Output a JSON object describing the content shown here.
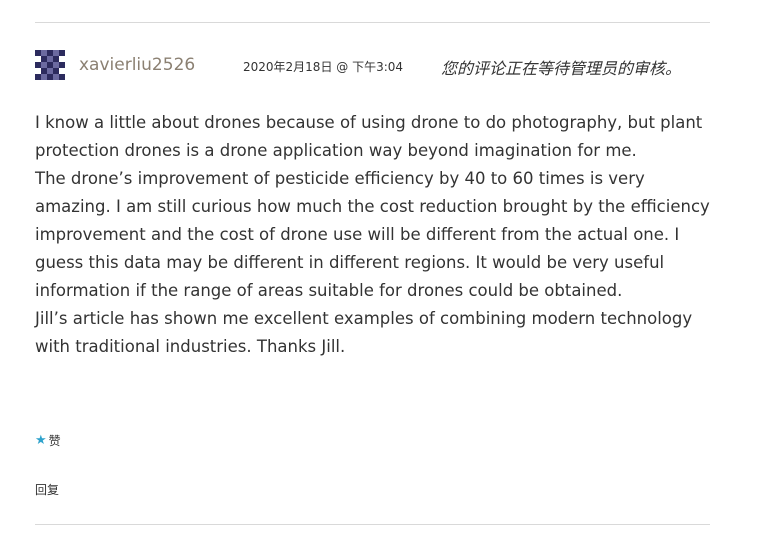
{
  "comment": {
    "author": "xavierliu2526",
    "date_time": "2020年2月18日 @ 下午3:04",
    "moderation_notice": "您的评论正在等待管理员的审核。",
    "paragraphs": [
      "I know a little about drones because of using drone to do photography, but plant protection drones is a drone application way beyond imagination for me.",
      "The drone’s improvement of pesticide efficiency by 40 to 60 times is very amazing. I am still curious how much the cost reduction brought by the efficiency improvement and the cost of drone use will be different from the actual one. I guess this data may be different in different regions. It would be very useful information if the range of areas suitable for drones could be obtained.",
      "Jill’s article has shown me excellent examples of combining modern technology with traditional industries. Thanks Jill."
    ],
    "like_label": "赞",
    "reply_label": "回复"
  },
  "icons": {
    "avatar": "identicon-avatar",
    "like": "star-icon"
  },
  "colors": {
    "author": "#8b8072",
    "text": "#333333",
    "star": "#2ea2cc",
    "divider": "#d9d9d9",
    "avatar": "#2c2b5e"
  }
}
